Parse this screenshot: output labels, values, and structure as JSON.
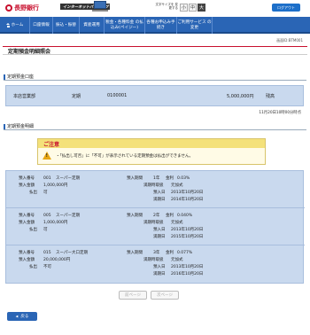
{
  "header": {
    "bank_name": "長野銀行",
    "service_banner": "インターネットバンキング",
    "fontsize_label": "文字サイズを 変更する",
    "fontsize_options": [
      "小",
      "中",
      "大"
    ],
    "logout_label": "ログアウト"
  },
  "nav": [
    {
      "label": "ホーム"
    },
    {
      "label": "口座情報"
    },
    {
      "label": "振込・振替"
    },
    {
      "label": "資産運用"
    },
    {
      "label": "税金・各種料金 の払込み(ペイジー)"
    },
    {
      "label": "各種お申込み手 続き"
    },
    {
      "label": "ご利用サービス の変更"
    }
  ],
  "screen_id": "画面ID:BTM001",
  "page_title": "定期預金明細照会",
  "section_account": "定期預金口座",
  "account": {
    "branch": "本店営業部",
    "type": "定期",
    "number": "0100001",
    "balance": "5,000,000円",
    "balance_suffix": "残高"
  },
  "update_time": "11月20日10時00分時点",
  "section_details": "定期預金明細",
  "notice": {
    "title": "ご注意",
    "text": "・「払出し可否」に「不可」が表示されている定期預金は払出ができません。"
  },
  "deposits": [
    {
      "no_label": "預入番号",
      "no": "001",
      "product": "スーパー定期",
      "amount_label": "預入金額",
      "amount": "1,000,000円",
      "withdraw_label": "払出",
      "withdraw": "可",
      "period_label": "預入期間",
      "period": "1年",
      "rate_label": "金利",
      "rate": "0.03%",
      "maturity_type_label": "満期時取扱",
      "maturity_type": "元加式",
      "start_label": "預入日",
      "start": "2013年10月20日",
      "end_label": "満期日",
      "end": "2014年10月20日"
    },
    {
      "no_label": "預入番号",
      "no": "005",
      "product": "スーパー定期",
      "amount_label": "預入金額",
      "amount": "1,000,000円",
      "withdraw_label": "払出",
      "withdraw": "可",
      "period_label": "預入期間",
      "period": "2年",
      "rate_label": "金利",
      "rate": "0.040%",
      "maturity_type_label": "満期時取扱",
      "maturity_type": "元加式",
      "start_label": "預入日",
      "start": "2013年10月20日",
      "end_label": "満期日",
      "end": "2015年10月20日"
    },
    {
      "no_label": "預入番号",
      "no": "015",
      "product": "スーパー大口定期",
      "amount_label": "預入金額",
      "amount": "20,000,000円",
      "withdraw_label": "払出",
      "withdraw": "不可",
      "period_label": "預入期間",
      "period": "3年",
      "rate_label": "金利",
      "rate": "0.077%",
      "maturity_type_label": "満期時取扱",
      "maturity_type": "元加式",
      "start_label": "預入日",
      "start": "2013年10月20日",
      "end_label": "満期日",
      "end": "2016年10月20日"
    }
  ],
  "paging": {
    "prev": "前ページ",
    "next": "次ページ"
  },
  "back_label": "戻る"
}
